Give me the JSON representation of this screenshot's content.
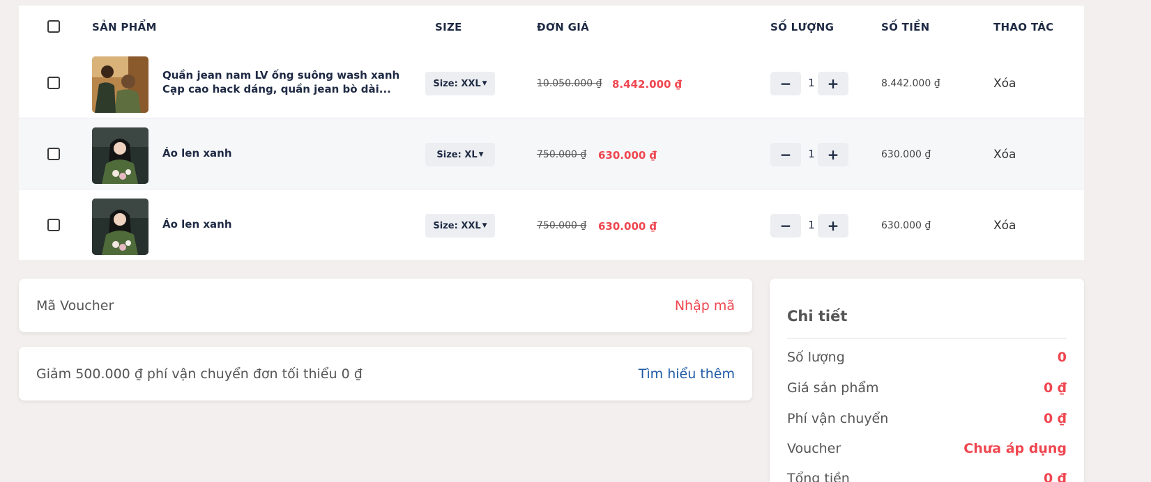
{
  "table": {
    "headers": {
      "product": "SẢN PHẨM",
      "size": "SIZE",
      "unit_price": "ĐƠN GIÁ",
      "quantity": "SỐ LƯỢNG",
      "amount": "SỐ TIỀN",
      "action": "THAO TÁC"
    },
    "rows": [
      {
        "name_line1": "Quần jean nam LV ống suông wash xanh",
        "name_line2": "Cạp cao hack dáng, quần jean bò dài...",
        "size": "Size: XXL",
        "old_price": "10.050.000 ₫",
        "new_price": "8.442.000 ₫",
        "qty": "1",
        "amount": "8.442.000 ₫",
        "delete": "Xóa"
      },
      {
        "name_line1": "Áo len xanh",
        "size": "Size: XL",
        "old_price": "750.000 ₫",
        "new_price": "630.000 ₫",
        "qty": "1",
        "amount": "630.000 ₫",
        "delete": "Xóa"
      },
      {
        "name_line1": "Áo len xanh",
        "size": "Size: XXL",
        "old_price": "750.000 ₫",
        "new_price": "630.000 ₫",
        "qty": "1",
        "amount": "630.000 ₫",
        "delete": "Xóa"
      }
    ],
    "minus_symbol": "−",
    "plus_symbol": "+"
  },
  "voucher": {
    "label": "Mã Voucher",
    "link": "Nhập mã"
  },
  "shipping_promo": {
    "label": "Giảm 500.000 ₫ phí vận chuyển đơn tối thiểu 0 ₫",
    "link": "Tìm hiểu thêm"
  },
  "detail": {
    "title": "Chi tiết",
    "rows": [
      {
        "label": "Số lượng",
        "value": "0"
      },
      {
        "label": "Giá sản phẩm",
        "value": "0 ₫"
      },
      {
        "label": "Phí vận chuyển",
        "value": "0 ₫"
      },
      {
        "label": "Voucher",
        "value": "Chưa áp dụng"
      },
      {
        "label": "Tổng tiền",
        "value": "0 ₫"
      }
    ]
  },
  "colors": {
    "accent": "#ef4650",
    "link_blue": "#1f5aa6",
    "background": "#f3efee",
    "header_text": "#1f2a44"
  }
}
